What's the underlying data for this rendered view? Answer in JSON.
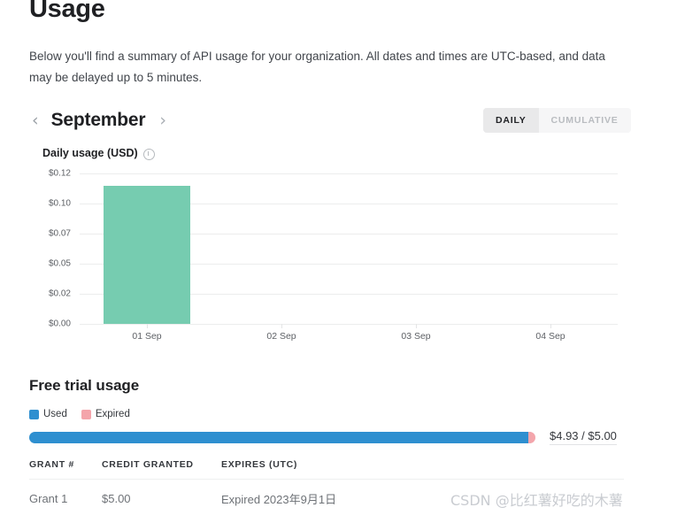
{
  "page": {
    "title": "Usage",
    "intro": "Below you'll find a summary of API usage for your organization. All dates and times are UTC-based, and data may be delayed up to 5 minutes."
  },
  "month_nav": {
    "prev_icon": "chevron-left-icon",
    "next_icon": "chevron-right-icon",
    "prev_label": "‹",
    "next_label": "›",
    "month": "September"
  },
  "view_toggle": {
    "options": [
      {
        "label": "DAILY",
        "active": true
      },
      {
        "label": "CUMULATIVE",
        "active": false
      }
    ]
  },
  "chart_header": {
    "title": "Daily usage (USD)",
    "info_icon": "info-circle-icon"
  },
  "chart_data": {
    "type": "bar",
    "title": "Daily usage (USD)",
    "xlabel": "",
    "ylabel": "",
    "categories": [
      "01 Sep",
      "02 Sep",
      "03 Sep",
      "04 Sep"
    ],
    "values": [
      0.115,
      0,
      0,
      0
    ],
    "ylim": [
      0,
      0.125
    ],
    "ytick_values": [
      0.125,
      0.1,
      0.075,
      0.05,
      0.025,
      0.0
    ],
    "ytick_labels": [
      "$0.12",
      "$0.10",
      "$0.07",
      "$0.05",
      "$0.02",
      "$0.00"
    ],
    "grid": true,
    "legend": "none",
    "bar_color": "#76ccb0",
    "grid_color": "#eceded"
  },
  "free_trial": {
    "title": "Free trial usage",
    "legend": [
      {
        "label": "Used",
        "color": "#2e8fd0",
        "swatch_icon": "used-swatch-icon"
      },
      {
        "label": "Expired",
        "color": "#f4a5ab",
        "swatch_icon": "expired-swatch-icon"
      }
    ],
    "progress": {
      "used_fraction": 0.986,
      "used_color": "#2e8fd0",
      "expired_color": "#f4a5ab",
      "amount": "$4.93 / $5.00"
    },
    "table": {
      "headers": [
        "GRANT #",
        "CREDIT GRANTED",
        "EXPIRES (UTC)"
      ],
      "rows": [
        {
          "grant": "Grant 1",
          "credit": "$5.00",
          "expires": "Expired 2023年9月1日"
        }
      ]
    }
  },
  "watermark": {
    "text": "CSDN @比红薯好吃的木薯"
  }
}
